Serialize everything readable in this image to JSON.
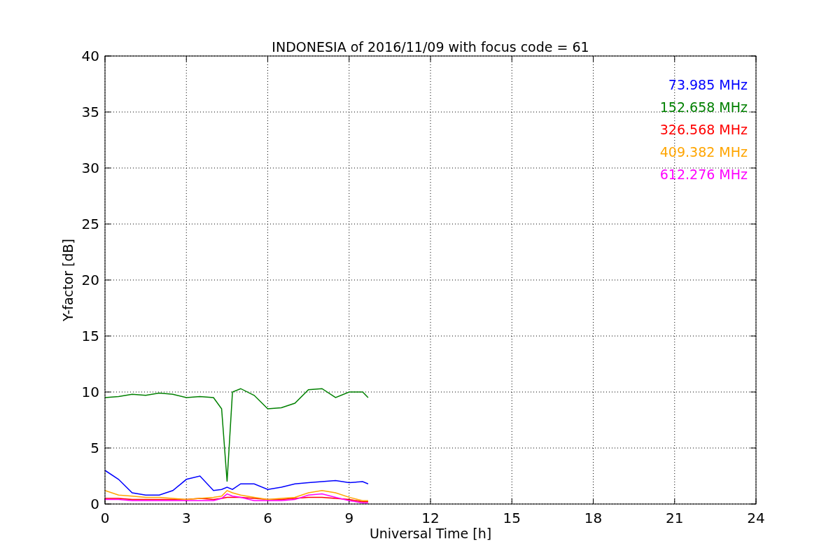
{
  "figure": {
    "chart_data": {
      "type": "line",
      "title": "INDONESIA of 2016/11/09 with focus code = 61",
      "xlabel": "Universal Time [h]",
      "ylabel": "Y-factor [dB]",
      "x": [
        0,
        0.5,
        1,
        1.5,
        2,
        2.5,
        3,
        3.5,
        4,
        4.3,
        4.5,
        4.7,
        5,
        5.5,
        6,
        6.5,
        7,
        7.5,
        8,
        8.5,
        9,
        9.5,
        9.7
      ],
      "series": [
        {
          "name": "73.985 MHz",
          "color": "#0000ff",
          "values": [
            3,
            2.2,
            1,
            0.8,
            0.8,
            1.2,
            2.2,
            2.5,
            1.2,
            1.3,
            1.5,
            1.3,
            1.8,
            1.8,
            1.3,
            1.5,
            1.8,
            1.9,
            2.0,
            2.1,
            1.9,
            2.0,
            1.8
          ]
        },
        {
          "name": "152.658 MHz",
          "color": "#008000",
          "values": [
            9.5,
            9.6,
            9.8,
            9.7,
            9.9,
            9.8,
            9.5,
            9.6,
            9.5,
            8.5,
            2,
            10,
            10.3,
            9.7,
            8.5,
            8.6,
            9.0,
            10.2,
            10.3,
            9.5,
            10,
            10,
            9.5
          ]
        },
        {
          "name": "326.568 MHz",
          "color": "#ff0000",
          "values": [
            0.5,
            0.5,
            0.4,
            0.4,
            0.4,
            0.4,
            0.4,
            0.5,
            0.4,
            0.5,
            0.6,
            0.6,
            0.6,
            0.5,
            0.4,
            0.4,
            0.5,
            0.6,
            0.6,
            0.5,
            0.4,
            0.2,
            0.2
          ]
        },
        {
          "name": "409.382 MHz",
          "color": "#ffa500",
          "values": [
            1.2,
            0.8,
            0.7,
            0.6,
            0.6,
            0.5,
            0.4,
            0.5,
            0.6,
            0.7,
            1.2,
            1.0,
            0.8,
            0.6,
            0.4,
            0.5,
            0.6,
            1.0,
            1.2,
            1.0,
            0.6,
            0.3,
            0.3
          ]
        },
        {
          "name": "612.276 MHz",
          "color": "#ff00ff",
          "values": [
            0.4,
            0.4,
            0.3,
            0.3,
            0.3,
            0.3,
            0.3,
            0.3,
            0.3,
            0.5,
            0.9,
            0.7,
            0.6,
            0.3,
            0.3,
            0.3,
            0.4,
            0.8,
            0.9,
            0.6,
            0.3,
            0.1,
            0.1
          ]
        }
      ],
      "xlim": [
        0,
        24
      ],
      "ylim": [
        0,
        40
      ],
      "xticks": [
        0,
        3,
        6,
        9,
        12,
        15,
        18,
        21,
        24
      ],
      "yticks": [
        0,
        5,
        10,
        15,
        20,
        25,
        30,
        35,
        40
      ],
      "grid": true
    }
  }
}
